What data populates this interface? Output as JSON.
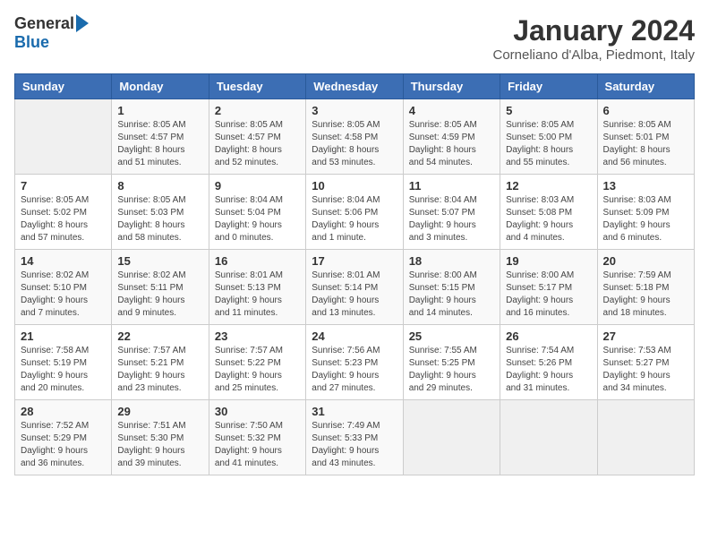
{
  "header": {
    "logo_general": "General",
    "logo_blue": "Blue",
    "title": "January 2024",
    "location": "Corneliano d'Alba, Piedmont, Italy"
  },
  "days_of_week": [
    "Sunday",
    "Monday",
    "Tuesday",
    "Wednesday",
    "Thursday",
    "Friday",
    "Saturday"
  ],
  "weeks": [
    [
      {
        "day": "",
        "info": ""
      },
      {
        "day": "1",
        "info": "Sunrise: 8:05 AM\nSunset: 4:57 PM\nDaylight: 8 hours\nand 51 minutes."
      },
      {
        "day": "2",
        "info": "Sunrise: 8:05 AM\nSunset: 4:57 PM\nDaylight: 8 hours\nand 52 minutes."
      },
      {
        "day": "3",
        "info": "Sunrise: 8:05 AM\nSunset: 4:58 PM\nDaylight: 8 hours\nand 53 minutes."
      },
      {
        "day": "4",
        "info": "Sunrise: 8:05 AM\nSunset: 4:59 PM\nDaylight: 8 hours\nand 54 minutes."
      },
      {
        "day": "5",
        "info": "Sunrise: 8:05 AM\nSunset: 5:00 PM\nDaylight: 8 hours\nand 55 minutes."
      },
      {
        "day": "6",
        "info": "Sunrise: 8:05 AM\nSunset: 5:01 PM\nDaylight: 8 hours\nand 56 minutes."
      }
    ],
    [
      {
        "day": "7",
        "info": "Sunrise: 8:05 AM\nSunset: 5:02 PM\nDaylight: 8 hours\nand 57 minutes."
      },
      {
        "day": "8",
        "info": "Sunrise: 8:05 AM\nSunset: 5:03 PM\nDaylight: 8 hours\nand 58 minutes."
      },
      {
        "day": "9",
        "info": "Sunrise: 8:04 AM\nSunset: 5:04 PM\nDaylight: 9 hours\nand 0 minutes."
      },
      {
        "day": "10",
        "info": "Sunrise: 8:04 AM\nSunset: 5:06 PM\nDaylight: 9 hours\nand 1 minute."
      },
      {
        "day": "11",
        "info": "Sunrise: 8:04 AM\nSunset: 5:07 PM\nDaylight: 9 hours\nand 3 minutes."
      },
      {
        "day": "12",
        "info": "Sunrise: 8:03 AM\nSunset: 5:08 PM\nDaylight: 9 hours\nand 4 minutes."
      },
      {
        "day": "13",
        "info": "Sunrise: 8:03 AM\nSunset: 5:09 PM\nDaylight: 9 hours\nand 6 minutes."
      }
    ],
    [
      {
        "day": "14",
        "info": "Sunrise: 8:02 AM\nSunset: 5:10 PM\nDaylight: 9 hours\nand 7 minutes."
      },
      {
        "day": "15",
        "info": "Sunrise: 8:02 AM\nSunset: 5:11 PM\nDaylight: 9 hours\nand 9 minutes."
      },
      {
        "day": "16",
        "info": "Sunrise: 8:01 AM\nSunset: 5:13 PM\nDaylight: 9 hours\nand 11 minutes."
      },
      {
        "day": "17",
        "info": "Sunrise: 8:01 AM\nSunset: 5:14 PM\nDaylight: 9 hours\nand 13 minutes."
      },
      {
        "day": "18",
        "info": "Sunrise: 8:00 AM\nSunset: 5:15 PM\nDaylight: 9 hours\nand 14 minutes."
      },
      {
        "day": "19",
        "info": "Sunrise: 8:00 AM\nSunset: 5:17 PM\nDaylight: 9 hours\nand 16 minutes."
      },
      {
        "day": "20",
        "info": "Sunrise: 7:59 AM\nSunset: 5:18 PM\nDaylight: 9 hours\nand 18 minutes."
      }
    ],
    [
      {
        "day": "21",
        "info": "Sunrise: 7:58 AM\nSunset: 5:19 PM\nDaylight: 9 hours\nand 20 minutes."
      },
      {
        "day": "22",
        "info": "Sunrise: 7:57 AM\nSunset: 5:21 PM\nDaylight: 9 hours\nand 23 minutes."
      },
      {
        "day": "23",
        "info": "Sunrise: 7:57 AM\nSunset: 5:22 PM\nDaylight: 9 hours\nand 25 minutes."
      },
      {
        "day": "24",
        "info": "Sunrise: 7:56 AM\nSunset: 5:23 PM\nDaylight: 9 hours\nand 27 minutes."
      },
      {
        "day": "25",
        "info": "Sunrise: 7:55 AM\nSunset: 5:25 PM\nDaylight: 9 hours\nand 29 minutes."
      },
      {
        "day": "26",
        "info": "Sunrise: 7:54 AM\nSunset: 5:26 PM\nDaylight: 9 hours\nand 31 minutes."
      },
      {
        "day": "27",
        "info": "Sunrise: 7:53 AM\nSunset: 5:27 PM\nDaylight: 9 hours\nand 34 minutes."
      }
    ],
    [
      {
        "day": "28",
        "info": "Sunrise: 7:52 AM\nSunset: 5:29 PM\nDaylight: 9 hours\nand 36 minutes."
      },
      {
        "day": "29",
        "info": "Sunrise: 7:51 AM\nSunset: 5:30 PM\nDaylight: 9 hours\nand 39 minutes."
      },
      {
        "day": "30",
        "info": "Sunrise: 7:50 AM\nSunset: 5:32 PM\nDaylight: 9 hours\nand 41 minutes."
      },
      {
        "day": "31",
        "info": "Sunrise: 7:49 AM\nSunset: 5:33 PM\nDaylight: 9 hours\nand 43 minutes."
      },
      {
        "day": "",
        "info": ""
      },
      {
        "day": "",
        "info": ""
      },
      {
        "day": "",
        "info": ""
      }
    ]
  ]
}
